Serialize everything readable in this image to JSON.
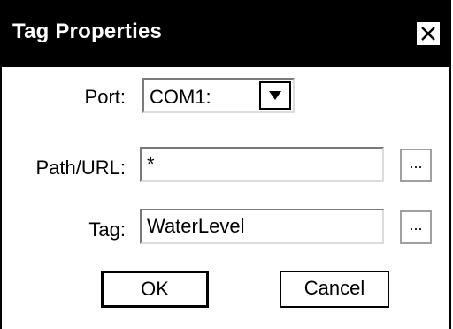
{
  "window": {
    "title": "Tag Properties",
    "close_glyph": "close-icon"
  },
  "form": {
    "port": {
      "label": "Port:",
      "value": "COM1:",
      "dropdown_icon": "triangle-down-icon"
    },
    "path": {
      "label": "Path/URL:",
      "value": "*",
      "browse_label": "..."
    },
    "tag": {
      "label": "Tag:",
      "value": "WaterLevel",
      "browse_label": "..."
    }
  },
  "buttons": {
    "ok_label": "OK",
    "cancel_label": "Cancel"
  },
  "colors": {
    "titlebar": "#000000",
    "title_text": "#ffffff",
    "background": "#ffffff"
  }
}
